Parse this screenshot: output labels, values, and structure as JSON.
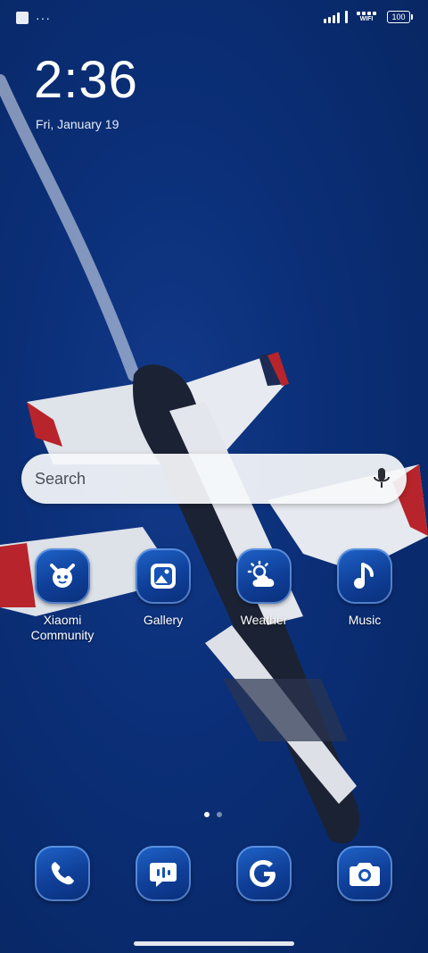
{
  "status_bar": {
    "left_icons": [
      "notification-square-icon",
      "more-dots-icon"
    ],
    "dots_text": "···",
    "wifi_label": "WIFI",
    "battery_level": "100"
  },
  "lockclock": {
    "time": "2:36",
    "date": "Fri, January 19"
  },
  "search": {
    "placeholder": "Search",
    "icon": "mic-icon"
  },
  "apps": [
    {
      "label": "Xiaomi\nCommunity",
      "icon": "xiaomi-community-icon"
    },
    {
      "label": "Gallery",
      "icon": "gallery-icon"
    },
    {
      "label": "Weather",
      "icon": "weather-icon"
    },
    {
      "label": "Music",
      "icon": "music-icon"
    }
  ],
  "dock": [
    {
      "icon": "phone-icon"
    },
    {
      "icon": "messages-icon"
    },
    {
      "icon": "google-icon"
    },
    {
      "icon": "camera-icon"
    }
  ],
  "pager": {
    "pages": 2,
    "current": 1
  },
  "colors": {
    "wallpaper": "#0b2f78",
    "icon_bg": "#1553b5",
    "search_bg": "#f5f7fa"
  }
}
